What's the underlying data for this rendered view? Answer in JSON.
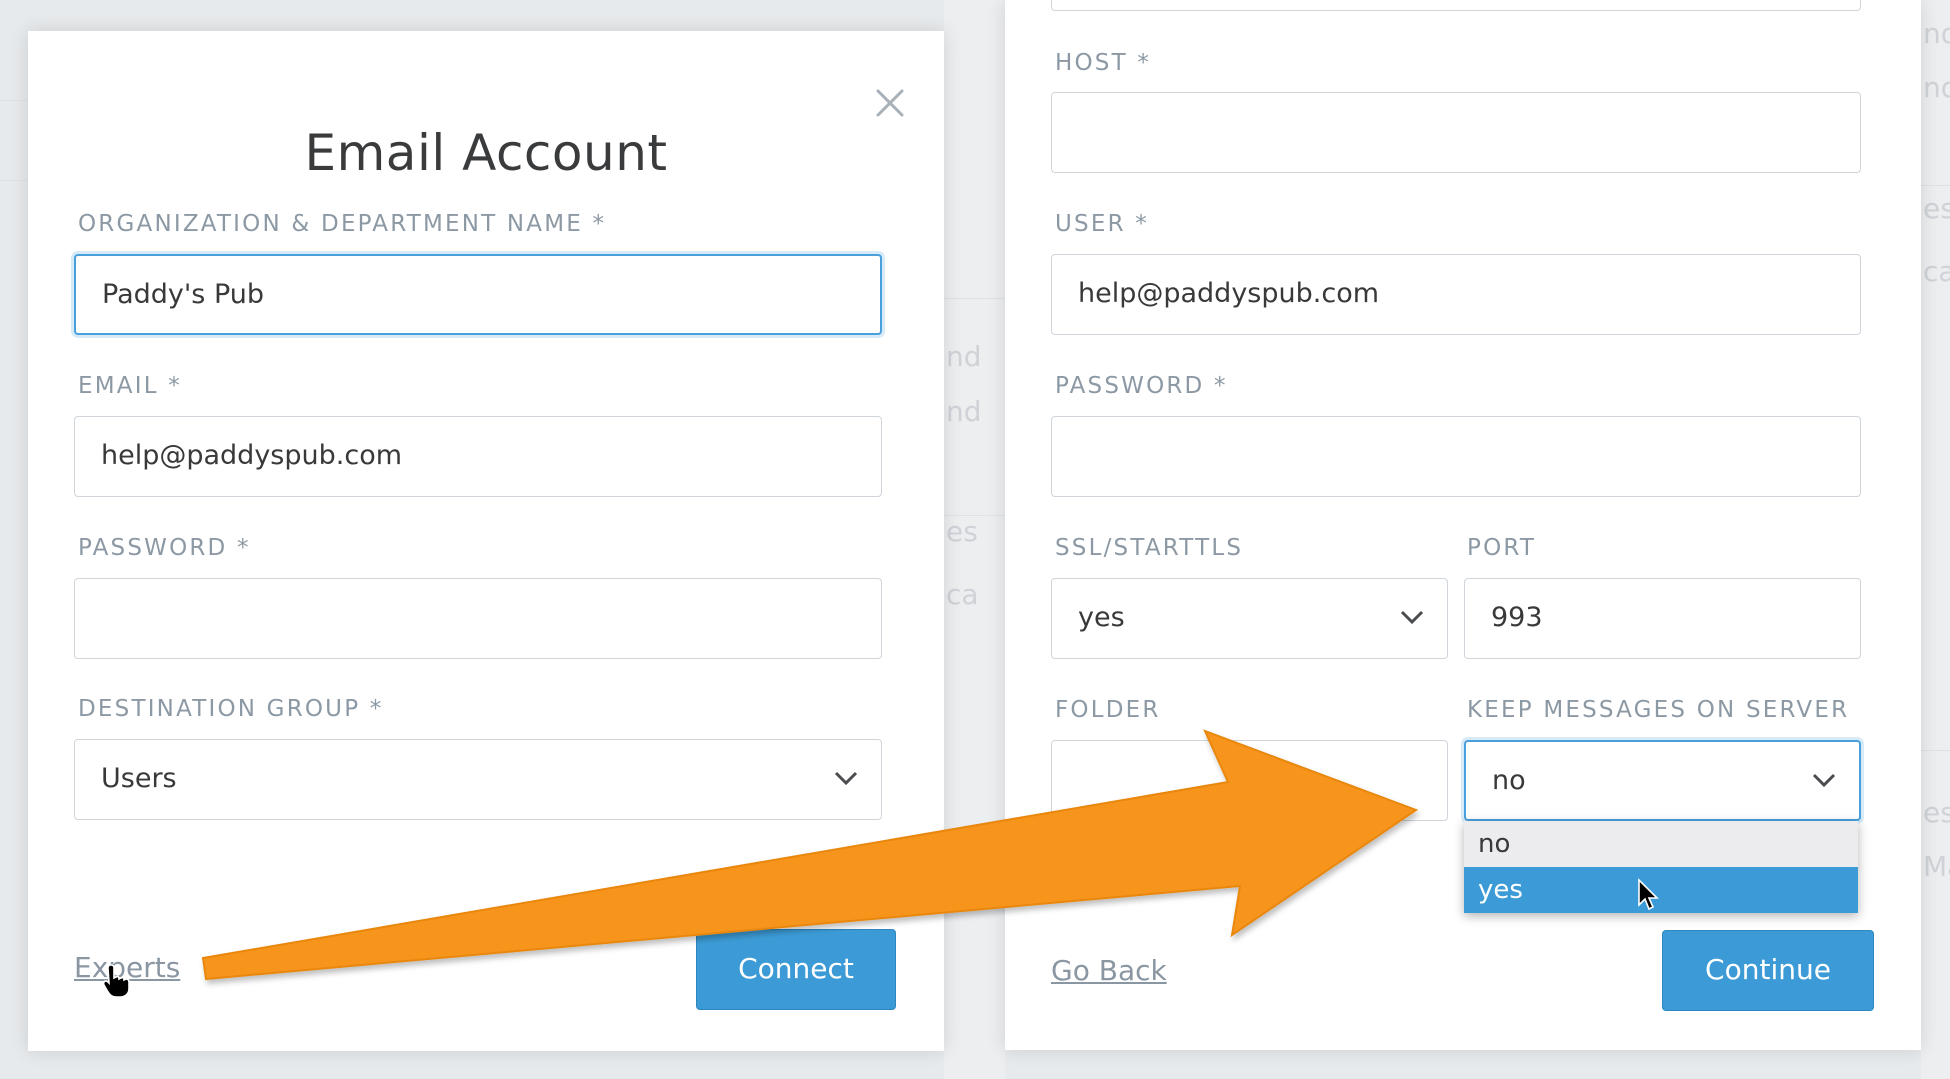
{
  "background": {
    "ghost_texts": [
      "nd",
      "nd",
      "nd",
      "nd",
      "es",
      "ca",
      "es",
      "ca",
      "es",
      "Ma"
    ]
  },
  "left_panel": {
    "title": "Email Account",
    "close_icon": "close-icon",
    "fields": {
      "organization": {
        "label": "ORGANIZATION & DEPARTMENT NAME *",
        "value": "Paddy's Pub"
      },
      "email": {
        "label": "EMAIL *",
        "value": "help@paddyspub.com"
      },
      "password": {
        "label": "PASSWORD *",
        "value": ""
      },
      "destination_group": {
        "label": "DESTINATION GROUP *",
        "value": "Users"
      }
    },
    "experts_link": "Experts",
    "connect_button": "Connect"
  },
  "right_panel": {
    "fields": {
      "host": {
        "label": "HOST *",
        "value": ""
      },
      "user": {
        "label": "USER *",
        "value": "help@paddyspub.com"
      },
      "password": {
        "label": "PASSWORD *",
        "value": ""
      },
      "ssl": {
        "label": "SSL/STARTTLS",
        "value": "yes"
      },
      "port": {
        "label": "PORT",
        "value": "993"
      },
      "folder": {
        "label": "FOLDER",
        "value": ""
      },
      "keep_messages": {
        "label": "KEEP MESSAGES ON SERVER",
        "value": "no"
      }
    },
    "dropdown_options": [
      "no",
      "yes"
    ],
    "go_back_link": "Go Back",
    "continue_button": "Continue"
  },
  "colors": {
    "accent": "#3c9bd6",
    "annotation_arrow": "#f7941d",
    "label": "#8c99a4"
  }
}
